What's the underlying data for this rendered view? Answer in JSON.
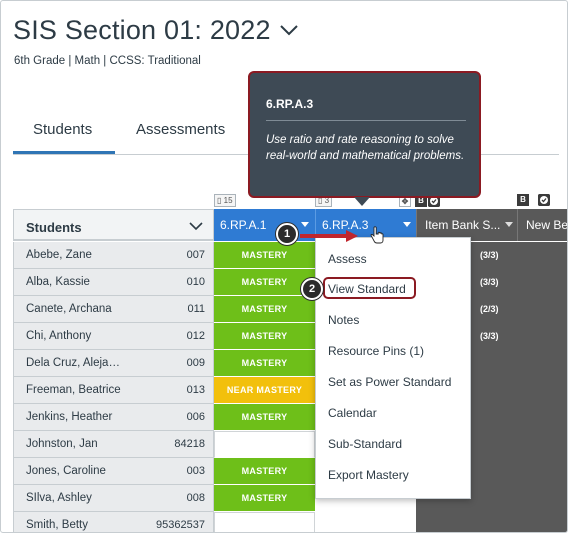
{
  "header": {
    "title": "SIS Section 01: 2022",
    "subtitle": "6th Grade  |  Math  |  CCSS: Traditional"
  },
  "tabs": [
    {
      "label": "Students",
      "active": true
    },
    {
      "label": "Assessments",
      "active": false
    }
  ],
  "tooltip": {
    "title": "6.RP.A.3",
    "description": "Use ratio and rate reasoning to solve real-world and mathematical problems."
  },
  "column_badges": {
    "col1_count": "15",
    "col2_count": "3",
    "bold_badge": "B"
  },
  "table": {
    "students_header": "Students",
    "columns": [
      "6.RP.A.1",
      "6.RP.A.3",
      "Item Bank S...",
      "New Be"
    ],
    "rows": [
      {
        "name": "Abebe, Zane",
        "id": "007",
        "c1": "MASTERY",
        "status": "mastery",
        "score": "(3/3)"
      },
      {
        "name": "Alba, Kassie",
        "id": "010",
        "c1": "MASTERY",
        "status": "mastery",
        "score": "(3/3)"
      },
      {
        "name": "Canete, Archana",
        "id": "011",
        "c1": "MASTERY",
        "status": "mastery",
        "score": "(2/3)"
      },
      {
        "name": "Chi, Anthony",
        "id": "012",
        "c1": "MASTERY",
        "status": "mastery",
        "score": "(3/3)"
      },
      {
        "name": "Dela Cruz, Aleja…",
        "id": "009",
        "c1": "MASTERY",
        "status": "mastery",
        "score": ""
      },
      {
        "name": "Freeman, Beatrice",
        "id": "013",
        "c1": "NEAR MASTERY",
        "status": "near",
        "score": ""
      },
      {
        "name": "Jenkins, Heather",
        "id": "006",
        "c1": "MASTERY",
        "status": "mastery",
        "score": ""
      },
      {
        "name": "Johnston, Jan",
        "id": "84218",
        "c1": "",
        "status": "blank",
        "score": ""
      },
      {
        "name": "Jones, Caroline",
        "id": "003",
        "c1": "MASTERY",
        "status": "mastery",
        "score": ""
      },
      {
        "name": "SIlva, Ashley",
        "id": "008",
        "c1": "MASTERY",
        "status": "mastery",
        "score": ""
      },
      {
        "name": "Smith, Betty",
        "id": "95362537",
        "c1": "",
        "status": "blank",
        "score": ""
      }
    ]
  },
  "context_menu": {
    "items": [
      "Assess",
      "View Standard",
      "Notes",
      "Resource Pins (1)",
      "Set as Power Standard",
      "Calendar",
      "Sub-Standard",
      "Export Mastery"
    ]
  },
  "callouts": {
    "step1": "1",
    "step2": "2"
  },
  "colors": {
    "mastery": "#6ebf19",
    "near_mastery": "#f2c00c",
    "header_blue": "#2f7bd3",
    "highlight_red": "#8b1a22",
    "arrow_red": "#c0262d"
  },
  "icons": [
    "chevron-down-icon",
    "check-icon",
    "hand-cursor-icon",
    "move-icon"
  ]
}
